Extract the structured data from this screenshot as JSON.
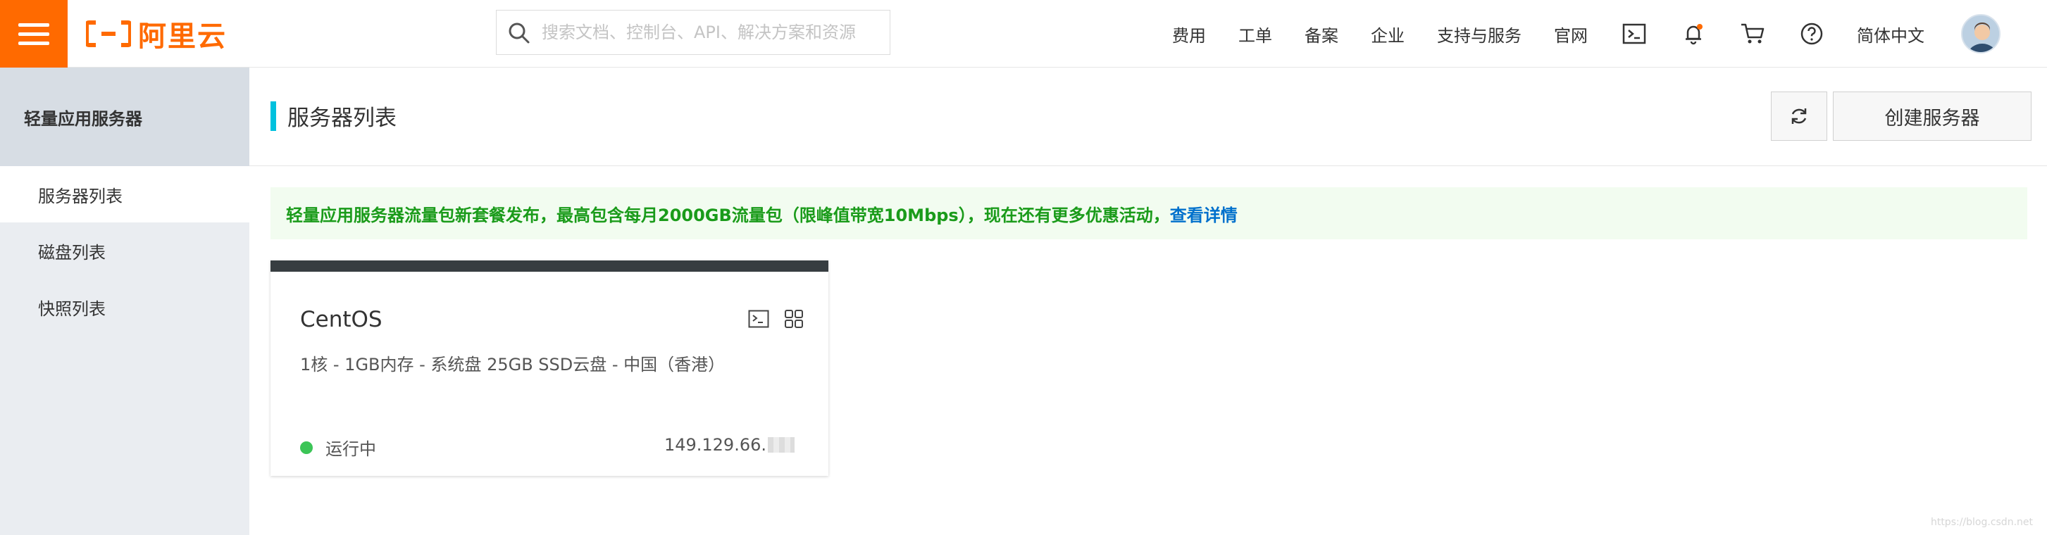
{
  "brand": {
    "logo_text": "阿里云",
    "accent": "#ff6a00"
  },
  "search": {
    "placeholder": "搜索文档、控制台、API、解决方案和资源"
  },
  "topnav": {
    "links": [
      "费用",
      "工单",
      "备案",
      "企业",
      "支持与服务",
      "官网"
    ],
    "language": "简体中文"
  },
  "sidebar": {
    "title": "轻量应用服务器",
    "items": [
      {
        "label": "服务器列表",
        "active": true
      },
      {
        "label": "磁盘列表",
        "active": false
      },
      {
        "label": "快照列表",
        "active": false
      }
    ]
  },
  "page": {
    "title": "服务器列表",
    "create_label": "创建服务器"
  },
  "notice": {
    "text": "轻量应用服务器流量包新套餐发布，最高包含每月2000GB流量包（限峰值带宽10Mbps），现在还有更多优惠活动，",
    "link": "查看详情"
  },
  "server_card": {
    "name": "CentOS",
    "spec": "1核 - 1GB内存 - 系统盘 25GB SSD云盘 - 中国（香港）",
    "status": "运行中",
    "status_color": "#3cc557",
    "ip": "149.129.66."
  },
  "watermark": "https://blog.csdn.net"
}
